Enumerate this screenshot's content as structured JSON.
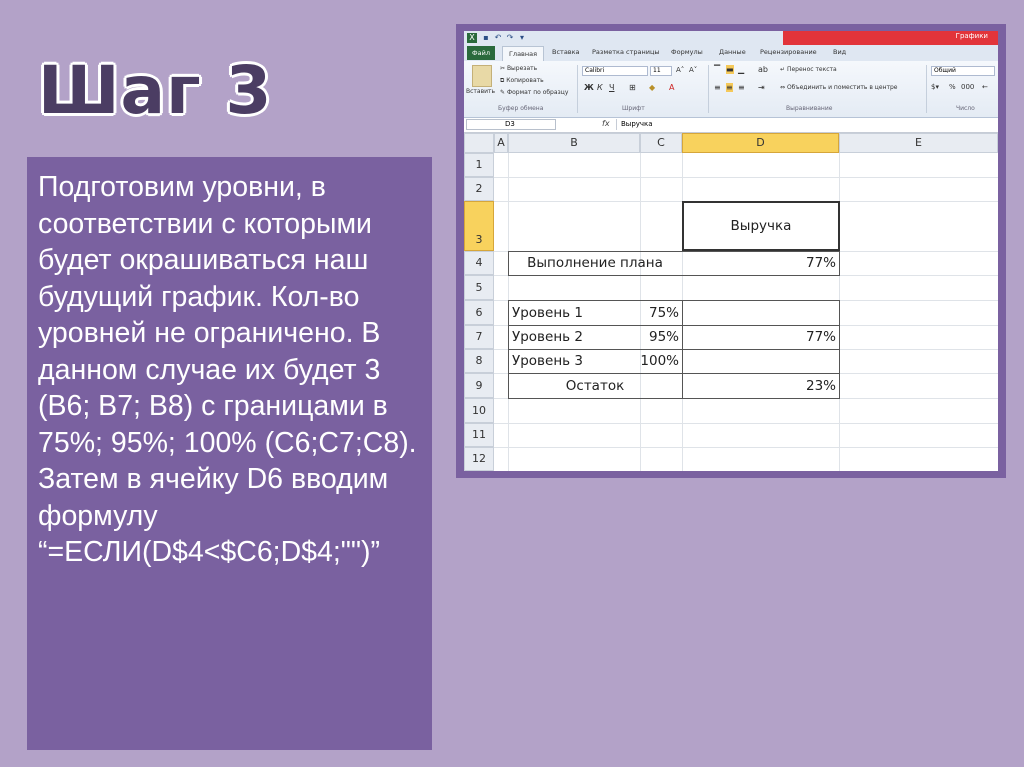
{
  "slide": {
    "title": "Шаг 3",
    "paragraphs": [
      "Подготовим уровни, в соответствии с которыми будет окрашиваться наш будущий график. Кол-во уровней не ограничено. В данном случае их будет 3 (В6; В7; В8) с границами в 75%; 95%; 100% (С6;С7;С8).",
      "Затем в ячейку D6 вводим формулу “=ЕСЛИ(D$4<$C6;D$4;\"\")”"
    ]
  },
  "excel": {
    "context_tab": "Графики",
    "tabs": [
      "Файл",
      "Главная",
      "Вставка",
      "Разметка страницы",
      "Формулы",
      "Данные",
      "Рецензирование",
      "Вид"
    ],
    "ribbon": {
      "paste": "Вставить",
      "cut": "Вырезать",
      "copy": "Копировать",
      "format_painter": "Формат по образцу",
      "clipboard_group": "Буфер обмена",
      "font_name": "Calibri",
      "font_size": "11",
      "font_group": "Шрифт",
      "wrap_text": "Перенос текста",
      "merge_center": "Объединить и поместить в центре",
      "alignment_group": "Выравнивание",
      "number_format": "Общий",
      "number_group": "Число",
      "percent": "%",
      "thousands": "000"
    },
    "name_box": "D3",
    "formula_value": "Выручка",
    "columns": [
      "A",
      "B",
      "C",
      "D",
      "E"
    ],
    "rows": [
      "1",
      "2",
      "3",
      "4",
      "5",
      "6",
      "7",
      "8",
      "9",
      "10",
      "11",
      "12"
    ],
    "cells": {
      "d3": "Выручка",
      "b4": "Выполнение плана",
      "d4": "77%",
      "b6": "Уровень 1",
      "c6": "75%",
      "b7": "Уровень 2",
      "c7": "95%",
      "d7": "77%",
      "b8": "Уровень 3",
      "c8": "100%",
      "b9": "Остаток",
      "d9": "23%"
    }
  }
}
